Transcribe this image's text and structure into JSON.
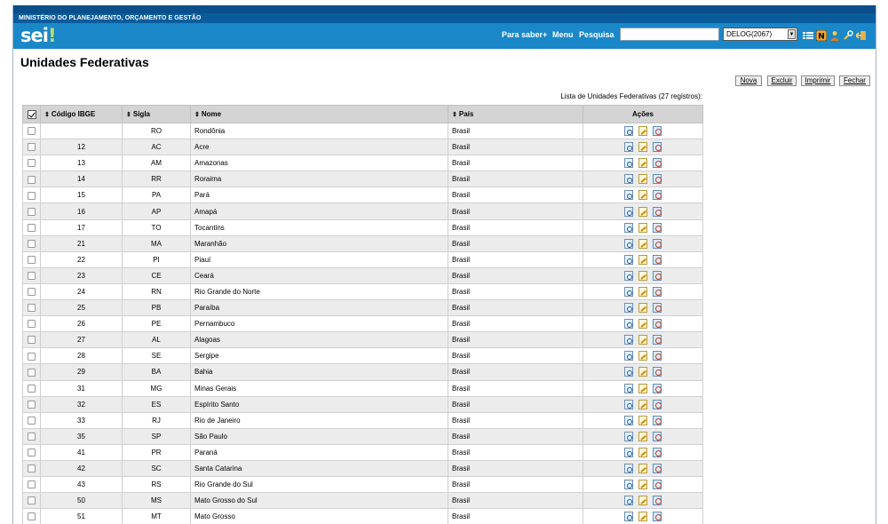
{
  "ministry": "MINISTÉRIO DO PLANEJAMENTO, ORÇAMENTO E GESTÃO",
  "logo": {
    "text": "sei",
    "mark": "!"
  },
  "nav": {
    "para_saber": "Para saber+",
    "menu": "Menu",
    "pesquisa": "Pesquisa"
  },
  "search": {
    "value": ""
  },
  "unit": {
    "selected": "DELOG(2067)"
  },
  "header_icons": [
    "list-icon",
    "n-badge-icon",
    "user-icon",
    "wrench-icon",
    "exit-icon"
  ],
  "page_title": "Unidades Federativas",
  "buttons": {
    "nova": "Nova",
    "excluir": "Excluir",
    "imprimir": "Imprimir",
    "fechar": "Fechar"
  },
  "caption": "Lista de Unidades Federativas (27 registros):",
  "columns": {
    "codigo": "Código IBGE",
    "sigla": "Sigla",
    "nome": "Nome",
    "pais": "País",
    "acoes": "Ações"
  },
  "rows": [
    {
      "codigo": "",
      "sigla": "RO",
      "nome": "Rondônia",
      "pais": "Brasil"
    },
    {
      "codigo": "12",
      "sigla": "AC",
      "nome": "Acre",
      "pais": "Brasil"
    },
    {
      "codigo": "13",
      "sigla": "AM",
      "nome": "Amazonas",
      "pais": "Brasil"
    },
    {
      "codigo": "14",
      "sigla": "RR",
      "nome": "Roraima",
      "pais": "Brasil"
    },
    {
      "codigo": "15",
      "sigla": "PA",
      "nome": "Pará",
      "pais": "Brasil"
    },
    {
      "codigo": "16",
      "sigla": "AP",
      "nome": "Amapá",
      "pais": "Brasil"
    },
    {
      "codigo": "17",
      "sigla": "TO",
      "nome": "Tocantins",
      "pais": "Brasil"
    },
    {
      "codigo": "21",
      "sigla": "MA",
      "nome": "Maranhão",
      "pais": "Brasil"
    },
    {
      "codigo": "22",
      "sigla": "PI",
      "nome": "Piauí",
      "pais": "Brasil"
    },
    {
      "codigo": "23",
      "sigla": "CE",
      "nome": "Ceará",
      "pais": "Brasil"
    },
    {
      "codigo": "24",
      "sigla": "RN",
      "nome": "Rio Grande do Norte",
      "pais": "Brasil"
    },
    {
      "codigo": "25",
      "sigla": "PB",
      "nome": "Paraíba",
      "pais": "Brasil"
    },
    {
      "codigo": "26",
      "sigla": "PE",
      "nome": "Pernambuco",
      "pais": "Brasil"
    },
    {
      "codigo": "27",
      "sigla": "AL",
      "nome": "Alagoas",
      "pais": "Brasil"
    },
    {
      "codigo": "28",
      "sigla": "SE",
      "nome": "Sergipe",
      "pais": "Brasil"
    },
    {
      "codigo": "29",
      "sigla": "BA",
      "nome": "Bahia",
      "pais": "Brasil"
    },
    {
      "codigo": "31",
      "sigla": "MG",
      "nome": "Minas Gerais",
      "pais": "Brasil"
    },
    {
      "codigo": "32",
      "sigla": "ES",
      "nome": "Espírito Santo",
      "pais": "Brasil"
    },
    {
      "codigo": "33",
      "sigla": "RJ",
      "nome": "Rio de Janeiro",
      "pais": "Brasil"
    },
    {
      "codigo": "35",
      "sigla": "SP",
      "nome": "São Paulo",
      "pais": "Brasil"
    },
    {
      "codigo": "41",
      "sigla": "PR",
      "nome": "Paraná",
      "pais": "Brasil"
    },
    {
      "codigo": "42",
      "sigla": "SC",
      "nome": "Santa Catarina",
      "pais": "Brasil"
    },
    {
      "codigo": "43",
      "sigla": "RS",
      "nome": "Rio Grande do Sul",
      "pais": "Brasil"
    },
    {
      "codigo": "50",
      "sigla": "MS",
      "nome": "Mato Grosso do Sul",
      "pais": "Brasil"
    },
    {
      "codigo": "51",
      "sigla": "MT",
      "nome": "Mato Grosso",
      "pais": "Brasil"
    }
  ],
  "row_actions": [
    "consultar-icon",
    "alterar-icon",
    "desativar-icon"
  ]
}
